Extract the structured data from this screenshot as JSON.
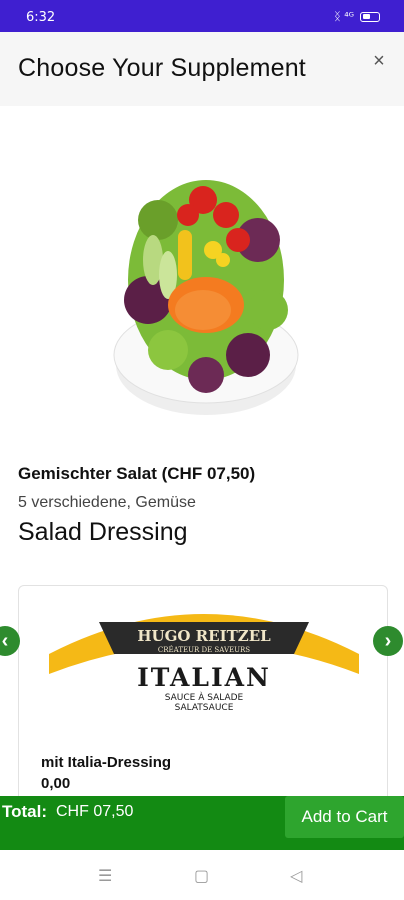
{
  "status_bar": {
    "time": "6:32",
    "icons_text": "ᛝ ⁴ᴳ▮"
  },
  "header": {
    "title": "Choose Your Supplement",
    "close_glyph": "×"
  },
  "product": {
    "name": "Gemischter Salat (CHF  07,50)",
    "description": "5 verschiedene, Gemüse",
    "image_icon": "salad-bowl"
  },
  "section": {
    "title": "Salad Dressing"
  },
  "dressing_option": {
    "brand": "HUGO REITZEL",
    "tagline": "CRÉATEUR DE SAVEURS",
    "product_label": "ITALIAN",
    "sub_label_1": "SAUCE À SALADE",
    "sub_label_2": "SALATSAUCE",
    "name": "mit Italia-Dressing",
    "price": "0,00"
  },
  "carousel": {
    "prev_glyph": "‹",
    "next_glyph": "›"
  },
  "footer": {
    "total_label": "Total:",
    "total_value": "CHF  07,50",
    "add_button": "Add to Cart"
  },
  "android_nav": {
    "menu_glyph": "☰",
    "home_glyph": "▢",
    "back_glyph": "◁"
  },
  "colors": {
    "status_bar": "#3f1fd0",
    "footer": "#138a13",
    "button": "#2ea52e",
    "arrow": "#2e8b2e"
  }
}
